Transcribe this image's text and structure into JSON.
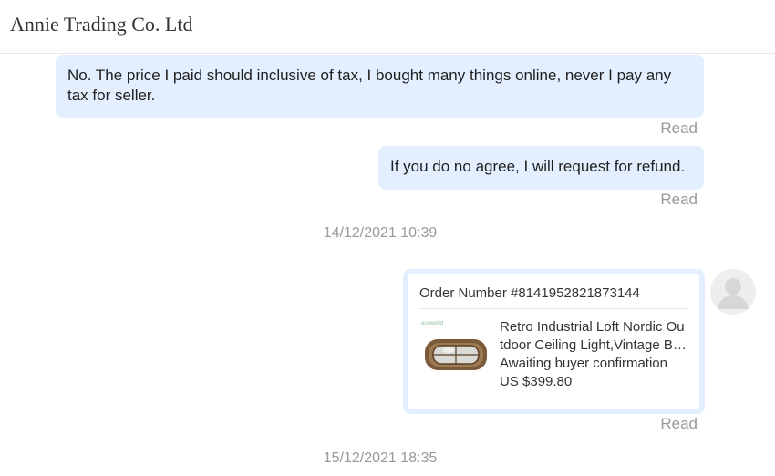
{
  "header": {
    "title": "Annie Trading Co. Ltd"
  },
  "messages": [
    {
      "text": "No. The price I paid should inclusive of tax, I bought many things online, never I pay any tax for seller.",
      "status": "Read"
    },
    {
      "text": "If you do no agree, I will request for refund.",
      "status": "Read"
    }
  ],
  "timestamps": [
    "14/12/2021 10:39",
    "15/12/2021 18:35"
  ],
  "order": {
    "number": "Order Number #8141952821873144",
    "thumb_brand": "ecoworld",
    "product_title_line1": "Retro Industrial Loft Nordic Ou",
    "product_title_line2": "tdoor Ceiling Light,Vintage B…",
    "status": "Awaiting buyer confirmation",
    "price": "US $399.80",
    "read_status": "Read"
  },
  "colors": {
    "bubble": "#e3efff",
    "muted": "#999999"
  },
  "icons": {
    "avatar": "user-avatar-icon"
  }
}
